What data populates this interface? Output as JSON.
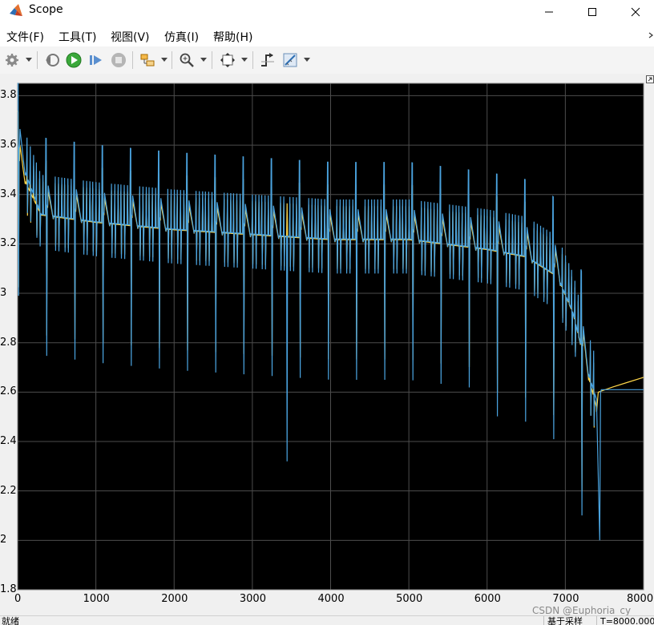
{
  "window": {
    "title": "Scope",
    "colors": {
      "plot_bg": "#000000",
      "grid": "#4d4d4d",
      "series_yellow": "#ffd74a",
      "series_blue": "#4aa3df"
    }
  },
  "menu": {
    "items": [
      "文件(F)",
      "工具(T)",
      "视图(V)",
      "仿真(I)",
      "帮助(H)"
    ]
  },
  "toolbar": {
    "icons": [
      "settings-icon",
      "step-back-icon",
      "run-icon",
      "step-forward-icon",
      "stop-icon",
      "highlight-block-icon",
      "zoom-icon",
      "fit-to-view-icon",
      "cursor-measure-icon",
      "triggers-icon"
    ]
  },
  "status": {
    "left": "就绪",
    "sample_mode": "基于采样",
    "time": "T=8000.000"
  },
  "watermark": "CSDN @Euphoria_cy",
  "chart_data": {
    "type": "line",
    "xlim": [
      0,
      8000
    ],
    "ylim": [
      1.8,
      3.85
    ],
    "x_ticks": [
      "0",
      "1000",
      "2000",
      "3000",
      "4000",
      "5000",
      "6000",
      "7000",
      "8000"
    ],
    "y_ticks": [
      "1.8",
      "2",
      "2.2",
      "2.4",
      "2.6",
      "2.8",
      "3",
      "3.2",
      "3.4",
      "3.6",
      "3.8"
    ],
    "grid": true,
    "series": [
      {
        "color": "#ffd74a",
        "plateau": {
          "x": [
            0,
            300,
            1000,
            2000,
            3000,
            4000,
            5000,
            6000,
            6500,
            6900,
            7100,
            7250,
            7400
          ],
          "y": [
            3.5,
            3.3,
            3.27,
            3.24,
            3.22,
            3.2,
            3.2,
            3.16,
            3.13,
            3.05,
            2.9,
            2.7,
            2.52
          ]
        },
        "tail": {
          "x": [
            7400,
            7420,
            7600,
            7800,
            8000
          ],
          "y": [
            2.52,
            2.6,
            2.62,
            2.64,
            2.66
          ]
        }
      },
      {
        "color": "#4aa3df",
        "plateau": {
          "x": [
            0,
            300,
            1000,
            2000,
            3000,
            4000,
            5000,
            6000,
            6500,
            6900,
            7100,
            7250,
            7400
          ],
          "y": [
            3.55,
            3.3,
            3.27,
            3.24,
            3.22,
            3.2,
            3.2,
            3.16,
            3.13,
            3.05,
            2.9,
            2.7,
            2.55
          ]
        },
        "tail": {
          "x": [
            7400,
            7440,
            7450,
            7460,
            8000
          ],
          "y": [
            2.55,
            2.0,
            2.6,
            2.61,
            2.61
          ]
        }
      }
    ]
  }
}
